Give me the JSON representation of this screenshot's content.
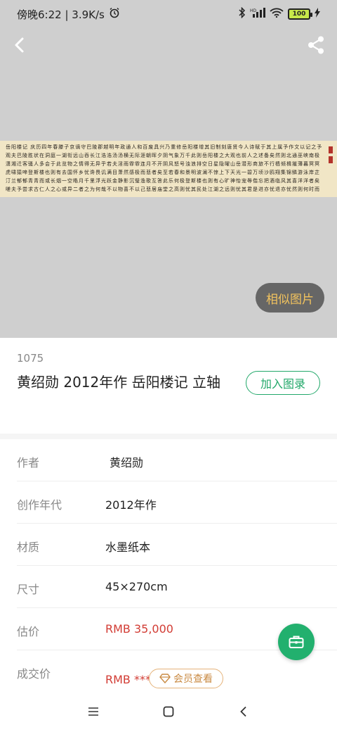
{
  "status": {
    "time_speed": "傍晚6:22 | 3.9K/s",
    "battery": "100"
  },
  "hero": {
    "scroll_text": "岳阳楼记 庆历四年春滕子京谪守巴陵郡越明年政通人和百废具兴乃重修岳阳楼增其旧制刻唐贤今人诗赋于其上属予作文以记之予观夫巴陵胜状在洞庭一湖衔远山吞长江浩浩汤汤横无际涯朝晖夕阴气象万千此则岳阳楼之大观也前人之述备矣然则北通巫峡南极潇湘迁客骚人多会于此览物之情得无异乎若夫淫雨霏霏连月不开阴风怒号浊浪排空日星隐曜山岳潜形商旅不行樯倾楫摧薄暮冥冥虎啸猿啼登斯楼也则有去国怀乡忧谗畏讥满目萧然感极而悲者矣至若春和景明波澜不惊上下天光一碧万顷沙鸥翔集锦鳞游泳岸芷汀兰郁郁青青而或长烟一空皓月千里浮光跃金静影沉璧渔歌互答此乐何极登斯楼也则有心旷神怡宠辱偕忘把酒临风其喜洋洋者矣嗟夫予尝求古仁人之心或异二者之为何哉不以物喜不以己悲居庙堂之高则忧其民处江湖之远则忧其君是进亦忧退亦忧然则何时而乐耶其必曰先天下之忧而忧后天下之乐而乐乎噫微斯人吾谁与归",
    "similar_label": "相似图片"
  },
  "lot": {
    "number": "1075",
    "title": "黄绍勋 2012年作 岳阳楼记 立轴",
    "catalog_label": "加入图录"
  },
  "details": [
    {
      "label": "作者",
      "value": "黄绍勋"
    },
    {
      "label": "创作年代",
      "value": "2012年作"
    },
    {
      "label": "材质",
      "value": "水墨纸本"
    },
    {
      "label": "尺寸",
      "value": "45×270cm"
    },
    {
      "label": "估价",
      "value": "RMB  35,000"
    },
    {
      "label": "成交价",
      "value": "RMB ****"
    }
  ],
  "vip_label": "会员查看",
  "colors": {
    "accent_green": "#22a86a",
    "price_red": "#d23c34",
    "vip_gold": "#c98a42",
    "similar_text": "#f2c35e"
  }
}
